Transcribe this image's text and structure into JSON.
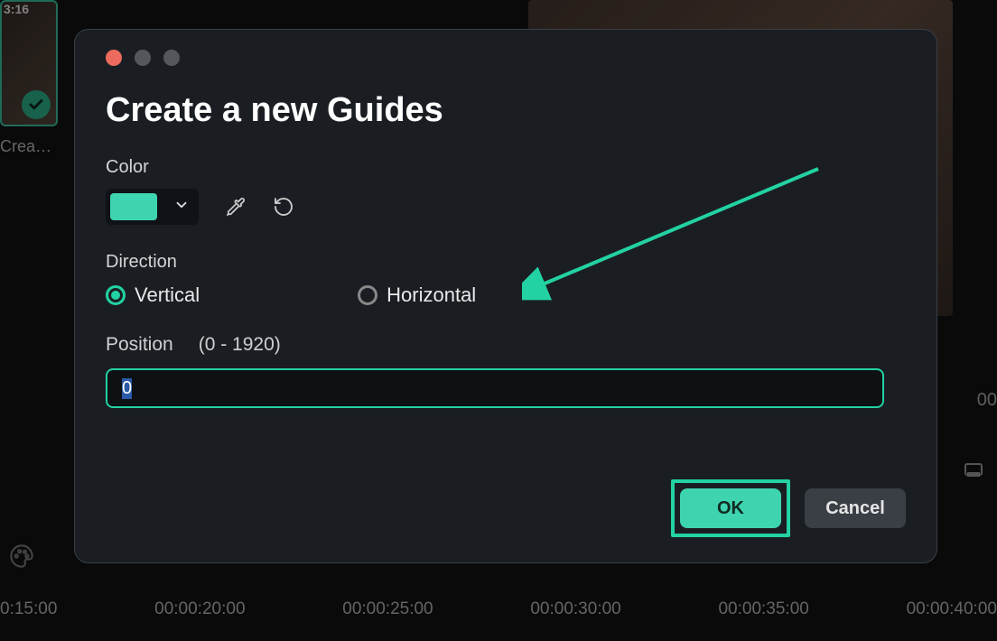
{
  "colors": {
    "accent": "#3fd4b0",
    "accent_alt": "#23d2a3",
    "dialog_bg": "#1a1e23"
  },
  "background": {
    "thumb_timestamp": "3:16",
    "thumb_label": "Crea…",
    "side_time": "00",
    "timeline_marks": [
      "0:15:00",
      "00:00:20:00",
      "00:00:25:00",
      "00:00:30:00",
      "00:00:35:00",
      "00:00:40:00"
    ]
  },
  "dialog": {
    "title": "Create a new Guides",
    "color": {
      "label": "Color",
      "swatch_hex": "#3fd4b0"
    },
    "direction": {
      "label": "Direction",
      "options": [
        {
          "key": "vertical",
          "label": "Vertical",
          "selected": true
        },
        {
          "key": "horizontal",
          "label": "Horizontal",
          "selected": false
        }
      ]
    },
    "position": {
      "label": "Position",
      "range_text": "(0 - 1920)",
      "value": "0"
    },
    "buttons": {
      "ok": "OK",
      "cancel": "Cancel"
    }
  },
  "icons": {
    "chevron_down": "chevron-down-icon",
    "eyedropper": "eyedropper-icon",
    "reset": "reset-icon",
    "palette": "palette-icon",
    "frame": "frame-icon",
    "check": "check-icon"
  }
}
